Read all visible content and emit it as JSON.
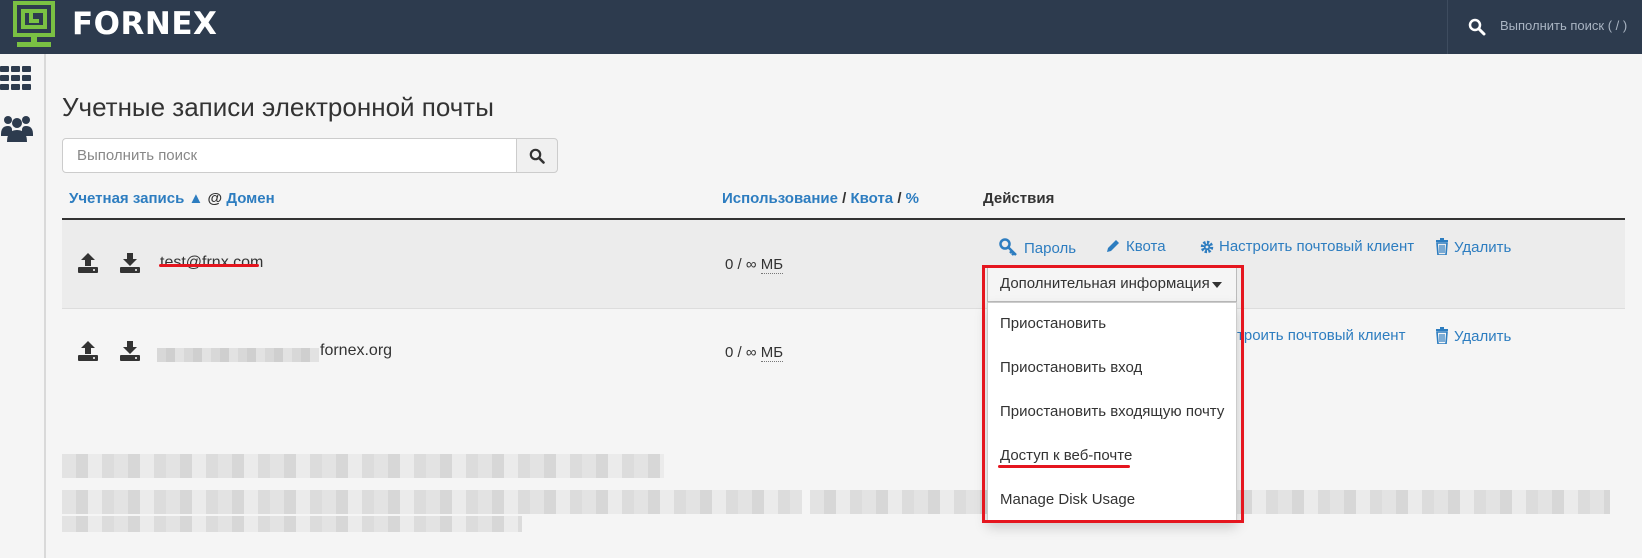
{
  "topbar": {
    "brand": "FORNEX",
    "search_placeholder": "Выполнить поиск ( / )",
    "bg_color": "#2d3b4e",
    "logo_color": "#7ac143"
  },
  "sidebar": {
    "items": [
      {
        "icon": "apps-grid-icon"
      },
      {
        "icon": "users-icon"
      }
    ]
  },
  "page": {
    "title": "Учетные записи электронной почты",
    "search_placeholder": "Выполнить поиск"
  },
  "table": {
    "headers": {
      "account": "Учетная запись",
      "sort_arrow": "▲",
      "at": "@",
      "domain": "Домен",
      "usage": "Использование",
      "slash": "/",
      "quota": "Квота",
      "percent": "%",
      "actions": "Действия"
    },
    "rows": [
      {
        "email": "test@frnx.com",
        "used": "0",
        "slash": "/",
        "quota": "∞",
        "unit": "МБ"
      },
      {
        "email_visible": "fornex.org",
        "used": "0",
        "slash": "/",
        "quota": "∞",
        "unit": "МБ"
      }
    ],
    "actions": {
      "password": "Пароль",
      "quota": "Квота",
      "configure_client": "Настроить почтовый клиент",
      "configure_client_partial": "троить почтовый клиент",
      "delete": "Удалить",
      "more_info": "Дополнительная информация"
    }
  },
  "dropdown_menu": {
    "items": [
      "Приостановить",
      "Приостановить вход",
      "Приостановить входящую почту",
      "Доступ к веб-почте",
      "Manage Disk Usage"
    ]
  },
  "colors": {
    "link": "#2d7dc0",
    "highlight": "#e5161f"
  }
}
